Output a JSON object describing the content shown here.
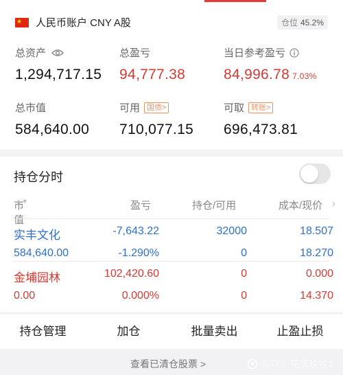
{
  "account": {
    "name": "人民币账户 CNY A股",
    "position_label": "仓位",
    "position_value": "45.2%"
  },
  "metrics": {
    "total_assets": {
      "label": "总资产",
      "value": "1,294,717.15"
    },
    "total_pnl": {
      "label": "总盈亏",
      "value": "94,777.38"
    },
    "daily_pnl": {
      "label": "当日参考盈亏",
      "value": "84,996.78",
      "pct": "7.03%"
    },
    "market_value": {
      "label": "总市值",
      "value": "584,640.00"
    },
    "available": {
      "label": "可用",
      "tag": "国债>",
      "value": "710,077.15"
    },
    "withdrawable": {
      "label": "可取",
      "tag": "转账>",
      "value": "696,473.81"
    }
  },
  "holdings": {
    "title": "持仓分时",
    "toggle_on": false,
    "columns": {
      "market_value": "市值",
      "pnl": "盈亏",
      "position": "持仓/可用",
      "cost": "成本/现价"
    },
    "rows": [
      {
        "name": "实丰文化",
        "market_value": "584,640.00",
        "pnl": "-7,643.22",
        "pnl_pct": "-1.290%",
        "position": "32000",
        "available": "0",
        "cost": "18.507",
        "price": "18.270"
      },
      {
        "name": "金埔园林",
        "market_value": "0.00",
        "pnl": "102,420.60",
        "pnl_pct": "0.000%",
        "position": "0",
        "available": "0",
        "cost": "0.000",
        "price": "14.370"
      }
    ]
  },
  "actions": [
    "持仓管理",
    "加仓",
    "批量卖出",
    "止盈止损"
  ],
  "footer": {
    "link": "查看已清仓股票 >",
    "watermark": "雪球：花落晚牧2"
  },
  "colors": {
    "red": "#d23b35",
    "blue": "#2f6fc9",
    "orange": "#e8935e"
  }
}
